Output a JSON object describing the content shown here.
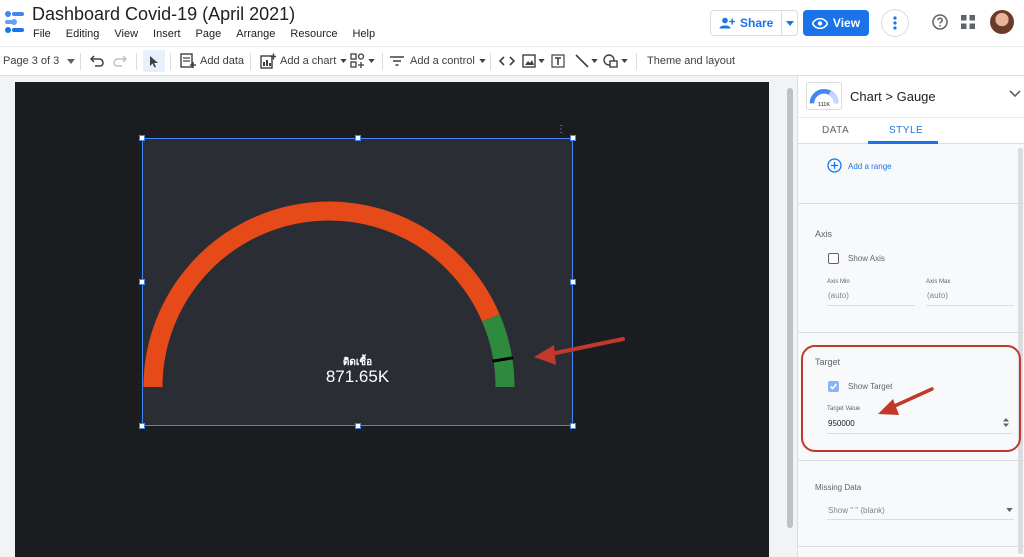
{
  "app": {
    "title": "Dashboard Covid-19 (April 2021)",
    "menu": [
      "File",
      "Editing",
      "View",
      "Insert",
      "Page",
      "Arrange",
      "Resource",
      "Help"
    ]
  },
  "header": {
    "share_label": "Share",
    "view_label": "View"
  },
  "toolbar": {
    "page_indicator": "Page 3 of 3",
    "add_data": "Add data",
    "add_chart": "Add a chart",
    "add_control": "Add a control",
    "theme_layout": "Theme and layout"
  },
  "gauge": {
    "label": "ติดเชื้อ",
    "value_text": "871.65K",
    "value": 871650,
    "target": 950000,
    "max": 1000000,
    "colors": {
      "main": "#e64a19",
      "range": "#2e8b3e",
      "target_marker": "#000000"
    }
  },
  "panel": {
    "breadcrumb": "Chart > Gauge",
    "thumb_text": "111K",
    "tabs": {
      "data": "DATA",
      "style": "STYLE"
    },
    "add_range": "Add a range",
    "axis": {
      "title": "Axis",
      "show_axis": "Show Axis",
      "min_label": "Axis Min",
      "max_label": "Axis Max",
      "min_value": "(auto)",
      "max_value": "(auto)"
    },
    "target": {
      "title": "Target",
      "show_target": "Show Target",
      "value_label": "Target Value",
      "value": "950000"
    },
    "missing": {
      "title": "Missing Data",
      "option": "Show \" \" (blank)"
    }
  },
  "colors": {
    "accent": "#1a73e8",
    "annotation": "#c0392b"
  }
}
